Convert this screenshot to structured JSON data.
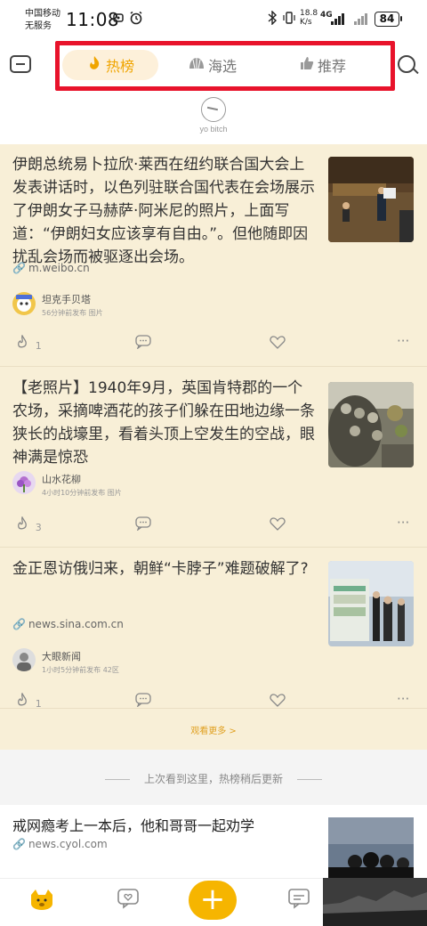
{
  "status": {
    "carrier_line1": "中国移动",
    "carrier_line2": "无服务",
    "time": "11:08",
    "net_speed_top": "18.8",
    "net_speed_unit": "K/s",
    "network": "4G",
    "battery": "84"
  },
  "header": {
    "tabs": [
      {
        "label": "热榜",
        "icon": "fire-icon",
        "active": true
      },
      {
        "label": "海选",
        "icon": "shell-icon",
        "active": false
      },
      {
        "label": "推荐",
        "icon": "thumbs-up-icon",
        "active": false
      }
    ],
    "mascot_label": "yo bitch"
  },
  "feed": {
    "cards": [
      {
        "title": "伊朗总统易卜拉欣·莱西在纽约联合国大会上发表讲话时，以色列驻联合国代表在会场展示了伊朗女子马赫萨·阿米尼的照片，上面写道：“伊朗妇女应该享有自由。”。但他随即因扰乱会场而被驱逐出会场。",
        "source": "m.weibo.cn",
        "author": "坦克手贝塔",
        "meta": "56分钟前发布  图片",
        "likes": "1"
      },
      {
        "title": "【老照片】1940年9月，英国肯特郡的一个农场，采摘啤酒花的孩子们躲在田地边缘一条狭长的战壕里，看着头顶上空发生的空战，眼神满是惊恐",
        "source": "",
        "author": "山水花柳",
        "meta": "4小时10分钟前发布  图片",
        "likes": "3"
      },
      {
        "title": "金正恩访俄归来，朝鲜“卡脖子”难题破解了?",
        "source": "news.sina.com.cn",
        "author": "大眼新闻",
        "meta": "1小时5分钟前发布  42区",
        "likes": "1"
      }
    ],
    "more_label": "观看更多 >"
  },
  "last_read": "上次看到这里，热榜稍后更新",
  "card5": {
    "title": "戒网瘾考上一本后，他和哥哥一起劝学",
    "source": "news.cyol.com"
  },
  "bottomnav": {
    "fab_label": "+"
  },
  "colors": {
    "accent": "#f6b500",
    "feed_bg": "#f8efd7",
    "highlight_box": "#e8132b"
  }
}
